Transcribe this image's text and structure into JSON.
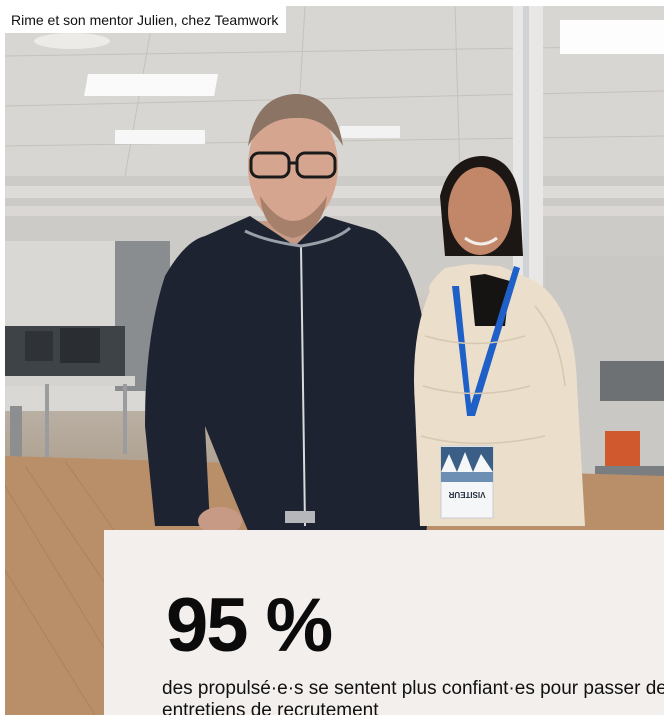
{
  "caption": "Rime et son mentor Julien, chez Teamwork",
  "badge": {
    "label": "VISITEUR"
  },
  "stat": {
    "value": "95 %",
    "description": "des propulsé·e·s se sentent plus confiant·es pour passer des entretiens de recrutement"
  },
  "colors": {
    "card_background": "#f3efed",
    "lanyard": "#1f5fc8"
  }
}
